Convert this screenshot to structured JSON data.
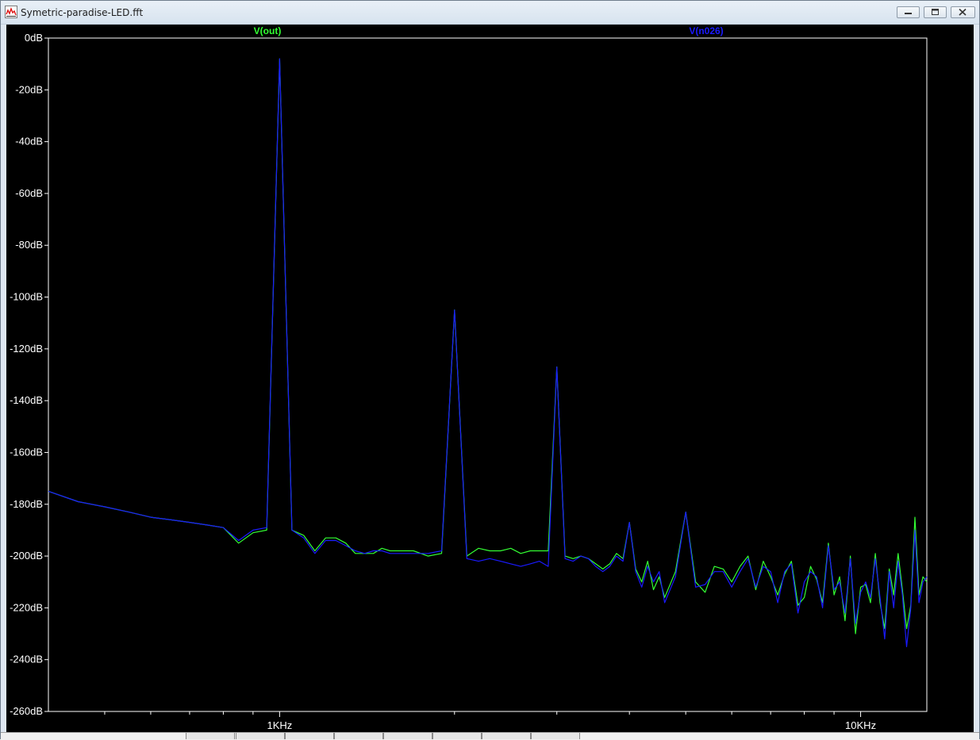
{
  "window": {
    "title": "Symetric-paradise-LED.fft"
  },
  "chart_data": {
    "type": "line",
    "title": "",
    "xlabel": "",
    "ylabel": "",
    "x_scale": "log",
    "xlim": [
      400,
      13000
    ],
    "ylim": [
      -260,
      0
    ],
    "yticks": [
      {
        "v": 0,
        "label": "0dB"
      },
      {
        "v": -20,
        "label": "-20dB"
      },
      {
        "v": -40,
        "label": "-40dB"
      },
      {
        "v": -60,
        "label": "-60dB"
      },
      {
        "v": -80,
        "label": "-80dB"
      },
      {
        "v": -100,
        "label": "-100dB"
      },
      {
        "v": -120,
        "label": "-120dB"
      },
      {
        "v": -140,
        "label": "-140dB"
      },
      {
        "v": -160,
        "label": "-160dB"
      },
      {
        "v": -180,
        "label": "-180dB"
      },
      {
        "v": -200,
        "label": "-200dB"
      },
      {
        "v": -220,
        "label": "-220dB"
      },
      {
        "v": -240,
        "label": "-240dB"
      },
      {
        "v": -260,
        "label": "-260dB"
      }
    ],
    "xticks_major": [
      {
        "v": 1000,
        "label": "1KHz"
      },
      {
        "v": 10000,
        "label": "10KHz"
      }
    ],
    "xticks_minor": [
      500,
      600,
      700,
      800,
      900,
      2000,
      3000,
      4000,
      5000,
      6000,
      7000,
      8000,
      9000
    ],
    "colors": {
      "background": "#000000",
      "axis": "#ffffff",
      "tick_label": "#ffffff"
    },
    "series": [
      {
        "name": "V(out)",
        "color": "#33ff33",
        "x": [
          400,
          450,
          500,
          550,
          600,
          650,
          700,
          750,
          800,
          850,
          900,
          950,
          1000,
          1050,
          1100,
          1150,
          1200,
          1250,
          1300,
          1350,
          1400,
          1450,
          1500,
          1550,
          1600,
          1700,
          1800,
          1900,
          2000,
          2100,
          2200,
          2300,
          2400,
          2500,
          2600,
          2700,
          2800,
          2900,
          3000,
          3100,
          3200,
          3300,
          3400,
          3500,
          3600,
          3700,
          3800,
          3900,
          4000,
          4100,
          4200,
          4300,
          4400,
          4500,
          4600,
          4800,
          5000,
          5200,
          5400,
          5600,
          5800,
          6000,
          6200,
          6400,
          6600,
          6800,
          7000,
          7200,
          7400,
          7600,
          7800,
          8000,
          8200,
          8400,
          8600,
          8800,
          9000,
          9200,
          9400,
          9600,
          9800,
          10000,
          10200,
          10400,
          10600,
          10800,
          11000,
          11200,
          11400,
          11600,
          11800,
          12000,
          12200,
          12400,
          12600,
          12800,
          13000
        ],
        "y": [
          -175,
          -179,
          -181,
          -183,
          -185,
          -186,
          -187,
          -188,
          -189,
          -195,
          -191,
          -190,
          -8,
          -190,
          -192,
          -198,
          -193,
          -193,
          -195,
          -199,
          -199,
          -199,
          -197,
          -198,
          -198,
          -198,
          -200,
          -199,
          -105,
          -200,
          -197,
          -198,
          -198,
          -197,
          -199,
          -198,
          -198,
          -198,
          -127,
          -200,
          -201,
          -200,
          -201,
          -203,
          -205,
          -203,
          -199,
          -201,
          -187,
          -205,
          -210,
          -202,
          -213,
          -208,
          -216,
          -206,
          -183,
          -210,
          -214,
          -204,
          -205,
          -210,
          -204,
          -200,
          -213,
          -202,
          -208,
          -215,
          -207,
          -202,
          -219,
          -216,
          -204,
          -209,
          -218,
          -195,
          -215,
          -208,
          -225,
          -200,
          -230,
          -212,
          -211,
          -218,
          -199,
          -218,
          -228,
          -205,
          -215,
          -199,
          -213,
          -228,
          -219,
          -185,
          -215,
          -208,
          -210
        ]
      },
      {
        "name": "V(n026)",
        "color": "#1a1aff",
        "x": [
          400,
          450,
          500,
          550,
          600,
          650,
          700,
          750,
          800,
          850,
          900,
          950,
          1000,
          1050,
          1100,
          1150,
          1200,
          1250,
          1300,
          1350,
          1400,
          1450,
          1500,
          1550,
          1600,
          1700,
          1800,
          1900,
          2000,
          2100,
          2200,
          2300,
          2400,
          2500,
          2600,
          2700,
          2800,
          2900,
          3000,
          3100,
          3200,
          3300,
          3400,
          3500,
          3600,
          3700,
          3800,
          3900,
          4000,
          4100,
          4200,
          4300,
          4400,
          4500,
          4600,
          4800,
          5000,
          5200,
          5400,
          5600,
          5800,
          6000,
          6200,
          6400,
          6600,
          6800,
          7000,
          7200,
          7400,
          7600,
          7800,
          8000,
          8200,
          8400,
          8600,
          8800,
          9000,
          9200,
          9400,
          9600,
          9800,
          10000,
          10200,
          10400,
          10600,
          10800,
          11000,
          11200,
          11400,
          11600,
          11800,
          12000,
          12200,
          12400,
          12600,
          12800,
          13000
        ],
        "y": [
          -175,
          -179,
          -181,
          -183,
          -185,
          -186,
          -187,
          -188,
          -189,
          -194,
          -190,
          -189,
          -8,
          -190,
          -193,
          -199,
          -194,
          -194,
          -196,
          -198,
          -199,
          -198,
          -198,
          -199,
          -199,
          -199,
          -199,
          -198,
          -105,
          -201,
          -202,
          -201,
          -202,
          -203,
          -204,
          -203,
          -202,
          -204,
          -127,
          -201,
          -202,
          -200,
          -201,
          -204,
          -206,
          -204,
          -200,
          -202,
          -187,
          -206,
          -212,
          -204,
          -210,
          -206,
          -218,
          -208,
          -183,
          -212,
          -211,
          -206,
          -206,
          -212,
          -206,
          -201,
          -212,
          -204,
          -206,
          -218,
          -206,
          -203,
          -222,
          -210,
          -206,
          -208,
          -220,
          -196,
          -213,
          -210,
          -222,
          -201,
          -226,
          -214,
          -210,
          -216,
          -201,
          -216,
          -232,
          -206,
          -220,
          -202,
          -215,
          -235,
          -220,
          -190,
          -218,
          -210,
          -208
        ]
      }
    ]
  }
}
